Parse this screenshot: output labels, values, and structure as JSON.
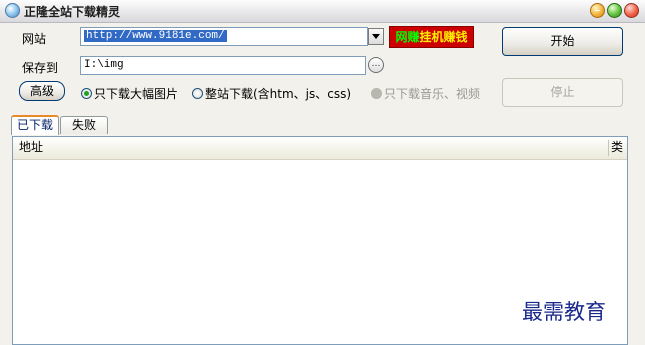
{
  "window": {
    "title": "正隆全站下载精灵",
    "app_icon": "globe-icon"
  },
  "form": {
    "site_label": "网站",
    "site_url": "http://www.9181e.com/",
    "save_label": "保存到",
    "save_path": "I:\\img",
    "browse_glyph": "…",
    "advanced_button": "高级"
  },
  "ad": {
    "text_part1": "网赚",
    "text_part2": "挂机赚钱"
  },
  "buttons": {
    "start": "开始",
    "stop": "停止"
  },
  "options": [
    {
      "label": "只下载大幅图片",
      "selected": true,
      "enabled": true
    },
    {
      "label": "整站下载(含htm、js、css)",
      "selected": false,
      "enabled": true
    },
    {
      "label": "只下载音乐、视频",
      "selected": false,
      "enabled": false
    }
  ],
  "tabs": [
    {
      "label": "已下载",
      "active": true
    },
    {
      "label": "失败",
      "active": false
    }
  ],
  "list": {
    "columns": [
      "地址",
      "类"
    ]
  },
  "watermark": "最需教育",
  "colors": {
    "ad_background": "#cc0000",
    "ad_text": "#ffee00",
    "ad_highlight": "#00ff00",
    "selection": "#316ac5",
    "watermark": "#1a2a8c"
  }
}
